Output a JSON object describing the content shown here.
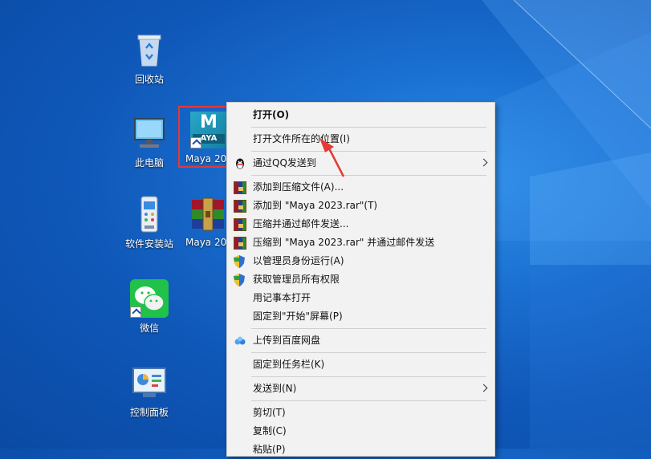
{
  "desktop": {
    "icons": [
      {
        "label": "回收站"
      },
      {
        "label": "此电脑"
      },
      {
        "label": "软件安装站"
      },
      {
        "label": "微信"
      },
      {
        "label": "控制面板"
      },
      {
        "label": "Maya 20"
      },
      {
        "label": "Maya 20"
      }
    ],
    "maya_badge": "M",
    "maya_sub": "AYA"
  },
  "context_menu": {
    "items": [
      {
        "label": "打开(O)"
      },
      {
        "label": "打开文件所在的位置(I)"
      },
      {
        "label": "通过QQ发送到"
      },
      {
        "label": "添加到压缩文件(A)..."
      },
      {
        "label": "添加到 \"Maya 2023.rar\"(T)"
      },
      {
        "label": "压缩并通过邮件发送..."
      },
      {
        "label": "压缩到 \"Maya 2023.rar\" 并通过邮件发送"
      },
      {
        "label": "以管理员身份运行(A)"
      },
      {
        "label": "获取管理员所有权限"
      },
      {
        "label": "用记事本打开"
      },
      {
        "label": "固定到\"开始\"屏幕(P)"
      },
      {
        "label": "上传到百度网盘"
      },
      {
        "label": "固定到任务栏(K)"
      },
      {
        "label": "发送到(N)"
      },
      {
        "label": "剪切(T)"
      },
      {
        "label": "复制(C)"
      },
      {
        "label": "粘贴(P)"
      }
    ]
  },
  "colors": {
    "highlight_box": "#e53935",
    "annotation_arrow": "#e53935"
  }
}
